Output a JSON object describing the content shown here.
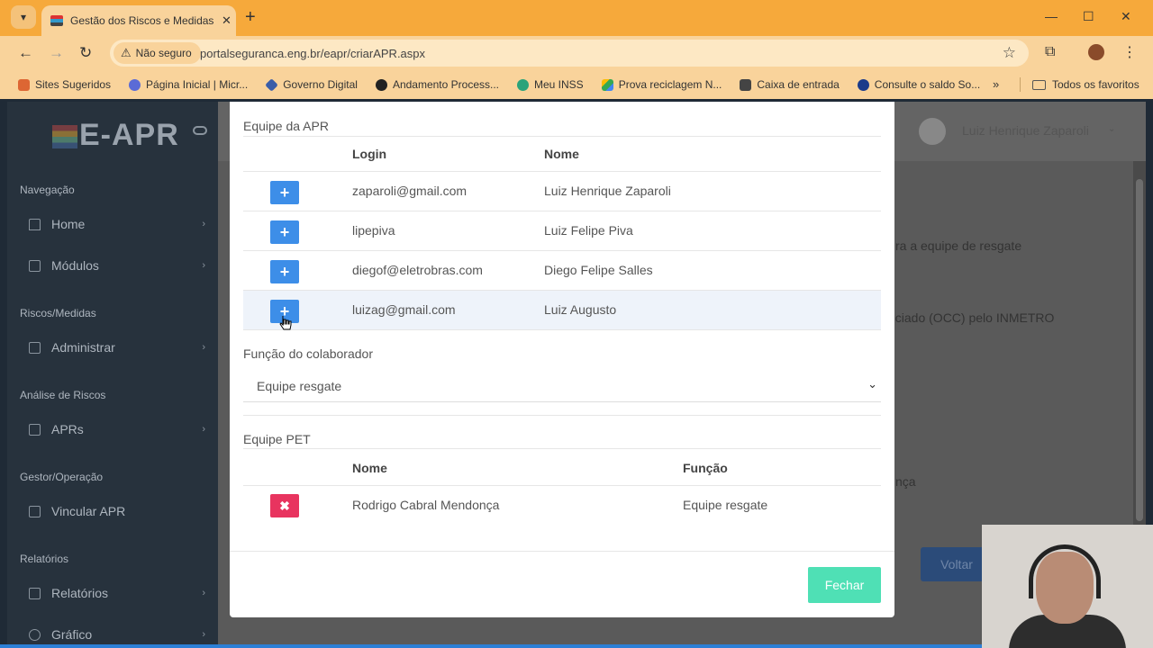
{
  "browser": {
    "tab_title": "Gestão dos Riscos e Medidas P",
    "url": "portalseguranca.eng.br/eapr/criarAPR.aspx",
    "security_label": "Não seguro",
    "bookmarks": [
      "Sites Sugeridos",
      "Página Inicial | Micr...",
      "Governo Digital",
      "Andamento Process...",
      "Meu INSS",
      "Prova reciclagem N...",
      "Caixa de entrada",
      "Consulte o saldo So..."
    ],
    "bookmarks_all": "Todos os favoritos",
    "colors": {
      "chrome": "#f6a93b",
      "chrome_light": "#f9d39b"
    }
  },
  "app": {
    "logo": "E-APR",
    "user_name": "Luiz Henrique Zaparoli",
    "sidebar": {
      "sections": [
        {
          "title": "Navegação",
          "items": [
            "Home",
            "Módulos"
          ]
        },
        {
          "title": "Riscos/Medidas",
          "items": [
            "Administrar"
          ]
        },
        {
          "title": "Análise de Riscos",
          "items": [
            "APRs"
          ]
        },
        {
          "title": "Gestor/Operação",
          "items": [
            "Vincular APR"
          ]
        },
        {
          "title": "Relatórios",
          "items": [
            "Relatórios",
            "Gráfico"
          ]
        }
      ]
    },
    "background": {
      "text1": "ra a equipe de resgate",
      "text2": "nciado (OCC) pelo INMETRO",
      "text3": "nça",
      "back_button": "Voltar"
    }
  },
  "modal": {
    "team_title": "Equipe da APR",
    "team_headers": {
      "login": "Login",
      "name": "Nome"
    },
    "team_rows": [
      {
        "login": "zaparoli@gmail.com",
        "name": "Luiz Henrique Zaparoli"
      },
      {
        "login": "lipepiva",
        "name": "Luiz Felipe Piva"
      },
      {
        "login": "diegof@eletrobras.com",
        "name": "Diego Felipe Salles"
      },
      {
        "login": "luizag@gmail.com",
        "name": "Luiz Augusto"
      }
    ],
    "role_label": "Função do colaborador",
    "role_value": "Equipe resgate",
    "pet_title": "Equipe PET",
    "pet_headers": {
      "name": "Nome",
      "role": "Função"
    },
    "pet_rows": [
      {
        "name": "Rodrigo Cabral Mendonça",
        "role": "Equipe resgate"
      }
    ],
    "close_button": "Fechar",
    "colors": {
      "add": "#3d8ee8",
      "remove": "#e8345f",
      "close": "#4fe0b5"
    }
  }
}
